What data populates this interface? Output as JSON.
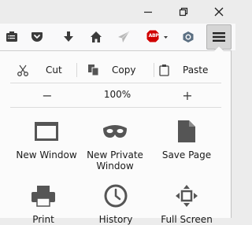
{
  "toolbar": {
    "icons": [
      "reading-list-icon",
      "pocket-icon",
      "download-icon",
      "home-icon",
      "send-tab-icon",
      "adblock-plus-icon",
      "privacy-badger-icon",
      "hamburger-menu-icon"
    ],
    "adblock_label": "ABP"
  },
  "window_controls": [
    "minimize-icon",
    "restore-icon",
    "close-icon"
  ],
  "menu": {
    "edit": {
      "cut": "Cut",
      "copy": "Copy",
      "paste": "Paste"
    },
    "zoom": {
      "minus": "−",
      "value": "100%",
      "plus": "+"
    },
    "items": [
      {
        "label": "New Window",
        "icon": "new-window-icon"
      },
      {
        "label": "New Private\nWindow",
        "icon": "private-mask-icon"
      },
      {
        "label": "Save Page",
        "icon": "save-page-icon"
      },
      {
        "label": "Print",
        "icon": "print-icon"
      },
      {
        "label": "History",
        "icon": "history-clock-icon"
      },
      {
        "label": "Full Screen",
        "icon": "full-screen-icon"
      }
    ]
  },
  "colors": {
    "adblock_red": "#d00000",
    "toolbar_bg": "#f9f9fa",
    "panel_bg": "#fbfbfb",
    "menu_button_active": "#d5d5d5"
  }
}
